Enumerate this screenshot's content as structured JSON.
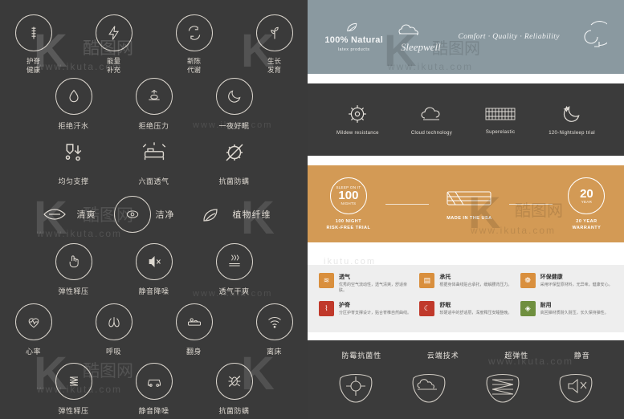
{
  "left": {
    "row1": [
      {
        "label": "护脊\n健康",
        "icon": "spine-health-icon"
      },
      {
        "label": "能量\n补充",
        "icon": "energy-icon"
      },
      {
        "label": "新陈\n代谢",
        "icon": "metabolism-icon"
      },
      {
        "label": "生长\n发育",
        "icon": "growth-icon"
      }
    ],
    "row2": [
      {
        "label": "拒绝汗水",
        "icon": "water-drop-icon"
      },
      {
        "label": "拒绝压力",
        "icon": "pressure-icon"
      },
      {
        "label": "一夜好眠",
        "icon": "moon-icon"
      }
    ],
    "row3": [
      {
        "label": "均匀支撑",
        "icon": "support-icon"
      },
      {
        "label": "六面透气",
        "icon": "bed-breathable-icon"
      },
      {
        "label": "抗菌防螨",
        "icon": "antibacterial-icon"
      }
    ],
    "row4": [
      {
        "label": "清爽",
        "icon": "fresh-icon"
      },
      {
        "label": "洁净",
        "icon": "clean-icon"
      },
      {
        "label": "植物纤维",
        "icon": "plant-fiber-icon"
      }
    ],
    "row5": [
      {
        "label": "弹性释压",
        "icon": "elastic-pressure-icon"
      },
      {
        "label": "静音降噪",
        "icon": "mute-icon"
      },
      {
        "label": "透气干爽",
        "icon": "ventilation-icon"
      }
    ],
    "row6": [
      {
        "label": "心率",
        "icon": "heart-rate-icon"
      },
      {
        "label": "呼吸",
        "icon": "breathing-icon"
      },
      {
        "label": "翻身",
        "icon": "turn-over-icon"
      },
      {
        "label": "离床",
        "icon": "leave-bed-icon"
      }
    ],
    "row7": [
      {
        "label": "弹性释压",
        "icon": "spring-icon"
      },
      {
        "label": "静音降噪",
        "icon": "car-quiet-icon"
      },
      {
        "label": "抗菌防螨",
        "icon": "anti-mite-icon"
      }
    ]
  },
  "right": {
    "band1": {
      "natural_title": "100% Natural",
      "natural_sub": "latex products",
      "brand": "Sleepwell",
      "tagline": "Comfort · Quality · Reliability"
    },
    "band2": [
      {
        "label": "Mildew resistance",
        "icon": "mildew-icon"
      },
      {
        "label": "Cloud technology",
        "icon": "cloud-icon"
      },
      {
        "label": "Superelastic",
        "icon": "spring-coil-icon"
      },
      {
        "label": "120-Nightsleep trial",
        "icon": "moon-star-icon"
      }
    ],
    "band3": {
      "seal_number": "100",
      "seal_top": "SLEEP ON IT",
      "seal_bottom": "NIGHTS",
      "left_label": "100 NIGHT\nRISK-FREE TRIAL",
      "mid_label": "MADE IN THE USA",
      "mid_icon": "flag-mattress-icon",
      "right_number": "20",
      "right_unit": "YEAR",
      "right_label": "20 YEAR\nWARRANTY"
    },
    "band4": [
      {
        "title": "透气",
        "desc": "优秀的空气流动性，透气清爽，舒适亲肤。",
        "icon": "breathable-icon",
        "color": "#d98f3d"
      },
      {
        "title": "承托",
        "desc": "根据身体曲线贴合承托，缓解腰背压力。",
        "icon": "support-icon",
        "color": "#d98f3d"
      },
      {
        "title": "环保健康",
        "desc": "采用环保型原材料，无异味，健康安心。",
        "icon": "eco-icon",
        "color": "#d98f3d"
      },
      {
        "title": "护脊",
        "desc": "分区护脊支撑设计，贴合脊椎自然曲线。",
        "icon": "spine-icon",
        "color": "#c0392b"
      },
      {
        "title": "舒眠",
        "desc": "软硬适中的舒适层，深度释压安睡整晚。",
        "icon": "sleep-icon",
        "color": "#c0392b"
      },
      {
        "title": "耐用",
        "desc": "高回弹材质耐久耐压，长久保持弹性。",
        "icon": "durable-icon",
        "color": "#6f8f3f"
      }
    ],
    "band5": {
      "titles": [
        "防霉抗菌性",
        "云端技术",
        "超弹性",
        "静音"
      ],
      "icons": [
        "mildew-sketch-icon",
        "cloud-sketch-icon",
        "spring-sketch-icon",
        "mute-sketch-icon"
      ]
    }
  },
  "watermark": {
    "k": "K",
    "cn": "酷图网",
    "site": "www.ikuta.com",
    "short": "ikutu.com"
  }
}
